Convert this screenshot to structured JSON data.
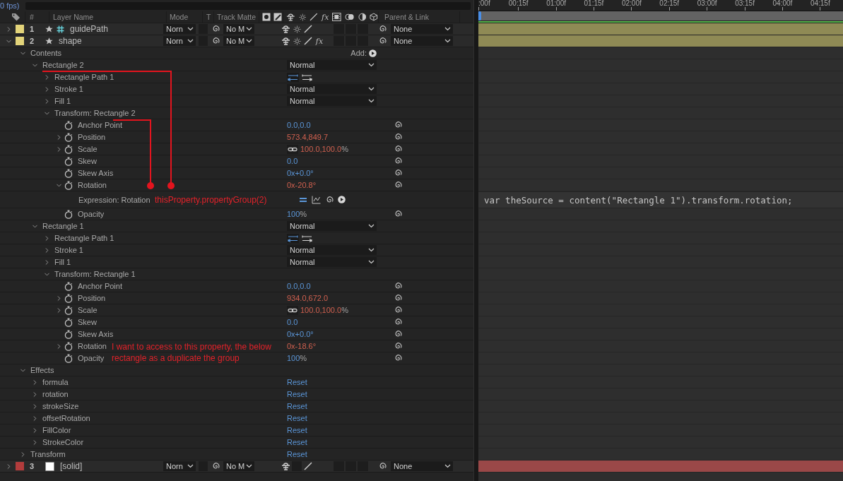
{
  "status": "0 fps)",
  "header": {
    "number": "#",
    "layer_name": "Layer Name",
    "mode": "Mode",
    "t": "T",
    "track_matte": "Track Matte",
    "fx": "fx",
    "parent": "Parent & Link"
  },
  "ruler": [
    ":00f",
    "00:15f",
    "01:00f",
    "01:15f",
    "02:00f",
    "02:15f",
    "03:00f",
    "03:15f",
    "04:00f",
    "04:15f"
  ],
  "layers": [
    {
      "number": "1",
      "name": "guidePath",
      "color": "#e3d47a",
      "bar": {
        "color": "#8f8a55"
      },
      "expanded": false,
      "icons": [
        {
          "kind": "shape"
        },
        {
          "kind": "guide"
        }
      ],
      "mode": "Norn",
      "track_matte": "No M",
      "parent": "None",
      "switches": [
        {
          "kind": "shy"
        },
        {
          "kind": "quality"
        },
        {
          "kind": "slash"
        }
      ]
    },
    {
      "number": "2",
      "name": "shape",
      "color": "#e3d47a",
      "bar": {
        "color": "#8f8a55"
      },
      "expanded": true,
      "icons": [
        {
          "kind": "shape"
        }
      ],
      "mode": "Norn",
      "track_matte": "No M",
      "parent": "None",
      "switches": [
        {
          "kind": "shy"
        },
        {
          "kind": "quality"
        },
        {
          "kind": "slash"
        },
        {
          "kind": "fx",
          "text": "fx",
          "on": true
        }
      ],
      "children": [
        {
          "kind": "group",
          "name": "Contents",
          "expanded": true,
          "add": "Add:",
          "children": [
            {
              "kind": "group",
              "name": "Rectangle 2",
              "expanded": true,
              "blend": "Normal",
              "children": [
                {
                  "kind": "path",
                  "name": "Rectangle Path 1",
                  "expanded": false
                },
                {
                  "kind": "group",
                  "name": "Stroke 1",
                  "expanded": false,
                  "blend": "Normal"
                },
                {
                  "kind": "group",
                  "name": "Fill 1",
                  "expanded": false,
                  "blend": "Normal"
                },
                {
                  "kind": "group",
                  "name": "Transform: Rectangle 2",
                  "expanded": true,
                  "children": [
                    {
                      "kind": "property",
                      "name": "Anchor Point",
                      "value": "0.0,0.0",
                      "expression": false
                    },
                    {
                      "kind": "property",
                      "name": "Position",
                      "expanded": false,
                      "value": "573.4,849.7",
                      "expression": true
                    },
                    {
                      "kind": "property",
                      "name": "Scale",
                      "expanded": false,
                      "linked": true,
                      "value": "100.0,100.0",
                      "unit": "%",
                      "expression": true
                    },
                    {
                      "kind": "property",
                      "name": "Skew",
                      "value": "0.0",
                      "expression": false
                    },
                    {
                      "kind": "property",
                      "name": "Skew Axis",
                      "value": "0x+0.0°",
                      "expression": false
                    },
                    {
                      "kind": "property",
                      "name": "Rotation",
                      "expanded": true,
                      "value": "0x-20.8°",
                      "expression": true,
                      "children": [
                        {
                          "kind": "expression",
                          "name": "Expression: Rotation",
                          "code": "var theSource = content(\"Rectangle 1\").transform.rotation;"
                        }
                      ]
                    },
                    {
                      "kind": "property",
                      "name": "Opacity",
                      "value": "100",
                      "unit": "%",
                      "expression": false
                    }
                  ]
                }
              ]
            },
            {
              "kind": "group",
              "name": "Rectangle 1",
              "expanded": true,
              "blend": "Normal",
              "children": [
                {
                  "kind": "path",
                  "name": "Rectangle Path 1",
                  "expanded": false
                },
                {
                  "kind": "group",
                  "name": "Stroke 1",
                  "expanded": false,
                  "blend": "Normal"
                },
                {
                  "kind": "group",
                  "name": "Fill 1",
                  "expanded": false,
                  "blend": "Normal"
                },
                {
                  "kind": "group",
                  "name": "Transform: Rectangle 1",
                  "expanded": true,
                  "children": [
                    {
                      "kind": "property",
                      "name": "Anchor Point",
                      "value": "0.0,0.0",
                      "expression": false
                    },
                    {
                      "kind": "property",
                      "name": "Position",
                      "expanded": false,
                      "value": "934.0,672.0",
                      "expression": true
                    },
                    {
                      "kind": "property",
                      "name": "Scale",
                      "expanded": false,
                      "linked": true,
                      "value": "100.0,100.0",
                      "unit": "%",
                      "expression": true
                    },
                    {
                      "kind": "property",
                      "name": "Skew",
                      "value": "0.0",
                      "expression": false
                    },
                    {
                      "kind": "property",
                      "name": "Skew Axis",
                      "value": "0x+0.0°",
                      "expression": false
                    },
                    {
                      "kind": "property",
                      "name": "Rotation",
                      "expanded": false,
                      "value": "0x-18.6°",
                      "expression": true
                    },
                    {
                      "kind": "property",
                      "name": "Opacity",
                      "value": "100",
                      "unit": "%",
                      "expression": false
                    }
                  ]
                }
              ]
            }
          ]
        },
        {
          "kind": "group",
          "name": "Effects",
          "expanded": true,
          "children": [
            {
              "kind": "effect",
              "name": "formula",
              "expanded": false,
              "reset": "Reset"
            },
            {
              "kind": "effect",
              "name": "rotation",
              "expanded": false,
              "reset": "Reset"
            },
            {
              "kind": "effect",
              "name": "strokeSize",
              "expanded": false,
              "reset": "Reset"
            },
            {
              "kind": "effect",
              "name": "offsetRotation",
              "expanded": false,
              "reset": "Reset"
            },
            {
              "kind": "effect",
              "name": "FillColor",
              "expanded": false,
              "reset": "Reset"
            },
            {
              "kind": "effect",
              "name": "StrokeColor",
              "expanded": false,
              "reset": "Reset"
            }
          ]
        },
        {
          "kind": "effect",
          "name": "Transform",
          "expanded": false,
          "reset": "Reset"
        }
      ]
    },
    {
      "number": "3",
      "name": "[solid]",
      "color": "#b23c3c",
      "bar": {
        "color": "#9a4848"
      },
      "expanded": false,
      "icons": [
        {
          "kind": "solid"
        }
      ],
      "mode": "Norn",
      "track_matte": "No M",
      "parent": "None",
      "switches": [
        {
          "kind": "shy"
        },
        {
          "kind": "blank"
        },
        {
          "kind": "slash"
        }
      ]
    }
  ],
  "annotations": [
    {
      "kind": "note",
      "text": "thisProperty.propertyGroup(2)"
    },
    {
      "kind": "note",
      "text": "I want to access to this property, the below rectangle as a duplicate the group"
    }
  ]
}
